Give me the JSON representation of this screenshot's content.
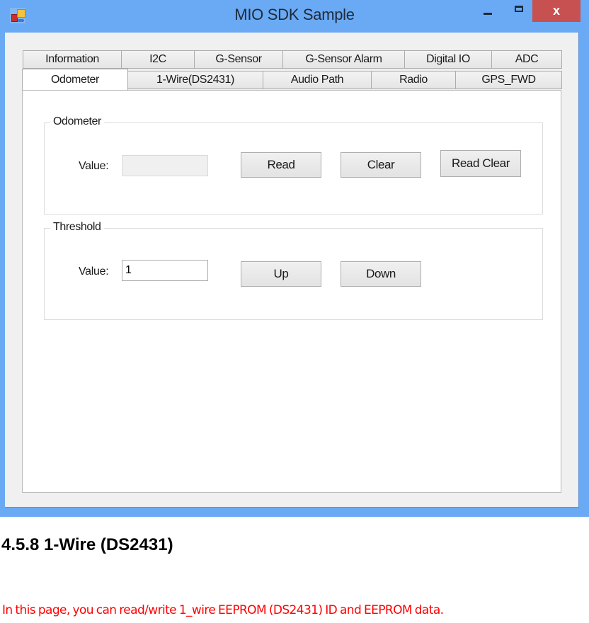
{
  "window": {
    "title": "MIO SDK Sample",
    "icon": "app-icon",
    "controls": {
      "minimize": "minimize-icon",
      "maximize": "maximize-icon",
      "close_glyph": "x"
    }
  },
  "tabs": {
    "row_back": [
      "Information",
      "I2C",
      "G-Sensor",
      "G-Sensor Alarm",
      "Digital IO",
      "ADC"
    ],
    "row_front": [
      "Odometer",
      "1-Wire(DS2431)",
      "Audio Path",
      "Radio",
      "GPS_FWD"
    ],
    "active": "Odometer"
  },
  "odometer_group": {
    "title": "Odometer",
    "value_label": "Value:",
    "value": "",
    "value_disabled": true,
    "buttons": [
      "Read",
      "Clear",
      "Read Clear"
    ]
  },
  "threshold_group": {
    "title": "Threshold",
    "value_label": "Value:",
    "value": "1",
    "buttons": [
      "Up",
      "Down"
    ]
  },
  "document": {
    "heading": "4.5.8 1-Wire (DS2431)",
    "note": "In this page, you can read/write 1_wire EEPROM (DS2431) ID and EEPROM data.",
    "note_color": "#ff0000"
  },
  "colors": {
    "frame": "#6aaaf4",
    "close_button": "#c75050",
    "client_bg": "#f0f0f0"
  }
}
